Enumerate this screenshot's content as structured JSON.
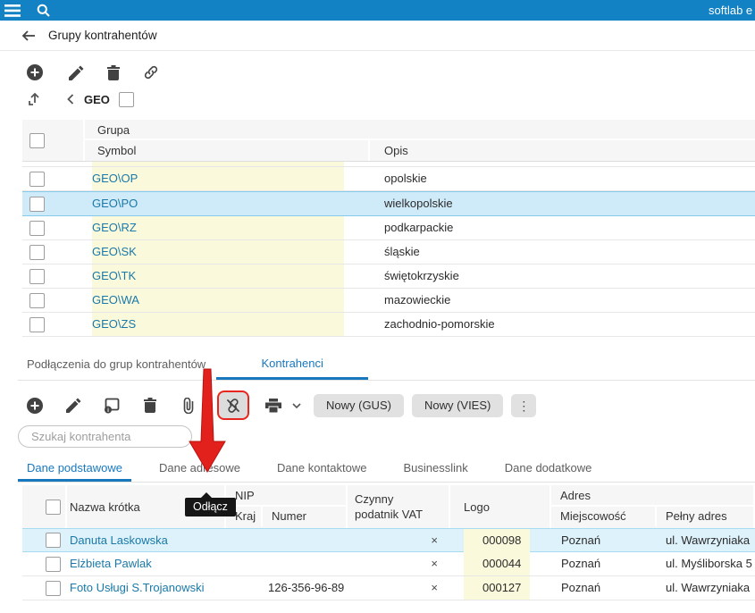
{
  "topbar": {
    "brand": "softlab e"
  },
  "page": {
    "title": "Grupy kontrahentów"
  },
  "groups_panel": {
    "path_label": "GEO",
    "table": {
      "group_header": "Grupa",
      "symbol_header": "Symbol",
      "opis_header": "Opis",
      "rows": [
        {
          "symbol": "GEO\\OP",
          "opis": "opolskie"
        },
        {
          "symbol": "GEO\\PO",
          "opis": "wielkopolskie"
        },
        {
          "symbol": "GEO\\RZ",
          "opis": "podkarpackie"
        },
        {
          "symbol": "GEO\\SK",
          "opis": "śląskie"
        },
        {
          "symbol": "GEO\\TK",
          "opis": "świętokrzyskie"
        },
        {
          "symbol": "GEO\\WA",
          "opis": "mazowieckie"
        },
        {
          "symbol": "GEO\\ZS",
          "opis": "zachodnio-pomorskie"
        }
      ]
    }
  },
  "section_tabs": {
    "connections": "Podłączenia do grup kontrahentów",
    "contractors": "Kontrahenci"
  },
  "contractors_panel": {
    "buttons": {
      "gus": "Nowy (GUS)",
      "vies": "Nowy (VIES)"
    },
    "search_placeholder": "Szukaj kontrahenta",
    "tooltip": "Odłącz",
    "tabs": {
      "basic": "Dane podstawowe",
      "address": "Dane adresowe",
      "contact": "Dane kontaktowe",
      "businesslink": "Businesslink",
      "additional": "Dane dodatkowe"
    },
    "table": {
      "headers": {
        "name": "Nazwa krótka",
        "nip": "NIP",
        "kraj": "Kraj",
        "numer": "Numer",
        "vat_line1": "Czynny",
        "vat_line2": "podatnik VAT",
        "logo": "Logo",
        "adres": "Adres",
        "city": "Miejscowość",
        "full_address": "Pełny adres"
      },
      "rows": [
        {
          "name": "Danuta Laskowska",
          "kraj": "",
          "numer": "",
          "vat": "×",
          "logo": "000098",
          "city": "Poznań",
          "address": "ul. Wawrzyniaka"
        },
        {
          "name": "Elżbieta Pawlak",
          "kraj": "",
          "numer": "",
          "vat": "×",
          "logo": "000044",
          "city": "Poznań",
          "address": "ul. Myśliborska 5"
        },
        {
          "name": "Foto Usługi S.Trojanowski",
          "kraj": "",
          "numer": "126-356-96-89",
          "vat": "×",
          "logo": "000127",
          "city": "Poznań",
          "address": "ul. Wawrzyniaka"
        }
      ]
    }
  }
}
